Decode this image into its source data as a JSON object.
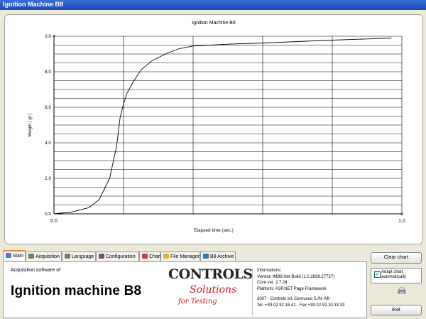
{
  "window": {
    "title": "Ignition Machine B8"
  },
  "chart_data": {
    "type": "line",
    "title": "Ignition Machine B8",
    "xlabel": "Elapsed time (sec.)",
    "ylabel": "Weight ( gr )",
    "xlim": [
      0.0,
      1.0
    ],
    "ylim": [
      0.0,
      10.0
    ],
    "x_ticks": [
      "0.0",
      "1.0"
    ],
    "y_ticks": [
      "0,0",
      "2,0",
      "4,0",
      "6,0",
      "8,0",
      "0,0"
    ],
    "grid": true,
    "x": [
      0.0,
      0.05,
      0.1,
      0.13,
      0.16,
      0.18,
      0.19,
      0.2,
      0.21,
      0.23,
      0.25,
      0.28,
      0.32,
      0.36,
      0.4,
      0.45,
      0.5,
      0.6,
      0.7,
      0.8,
      0.9,
      0.97
    ],
    "y": [
      0.0,
      0.1,
      0.35,
      0.8,
      2.0,
      3.8,
      5.4,
      6.2,
      6.8,
      7.5,
      8.1,
      8.6,
      9.0,
      9.3,
      9.45,
      9.5,
      9.55,
      9.62,
      9.7,
      9.78,
      9.85,
      9.9
    ]
  },
  "tabs": [
    {
      "label": "Main",
      "icon": "home-icon",
      "color": "#4a7bd0"
    },
    {
      "label": "Acquisition",
      "icon": "acquisition-icon",
      "color": "#5a8a4a"
    },
    {
      "label": "Language",
      "icon": "language-icon",
      "color": "#8a7a5a"
    },
    {
      "label": "Configuration",
      "icon": "configuration-icon",
      "color": "#7a4a8a"
    },
    {
      "label": "Chart",
      "icon": "chart-icon",
      "color": "#c04040"
    },
    {
      "label": "File Manager",
      "icon": "folder-icon",
      "color": "#e0b030"
    },
    {
      "label": "B8 Archive",
      "icon": "archive-icon",
      "color": "#3a7ab0"
    }
  ],
  "info": {
    "acquisition_label": "Acquisition software of",
    "app_title": "Ignition machine B8",
    "logo": {
      "controls": "CONTROLS",
      "solutions": "Solutions",
      "for_testing": "for Testing"
    },
    "lines": [
      "Informations:",
      "Version     IMB8.Net  Build (1.0.2839.27737)",
      "Core ver. 2.7.24",
      "Platform: ASP.NET Page Framework",
      "2007 - Controls srl, Cernusco S./N -MI-",
      "Tel. +39.02.92.18.41 - Fax +39.02.92.10.33.33"
    ]
  },
  "buttons": {
    "clear_chart": "Clear chart",
    "exit": "Exit"
  },
  "adapt_chart": {
    "label_line1": "Adapt chart",
    "label_line2": "automatically",
    "checked": true
  }
}
